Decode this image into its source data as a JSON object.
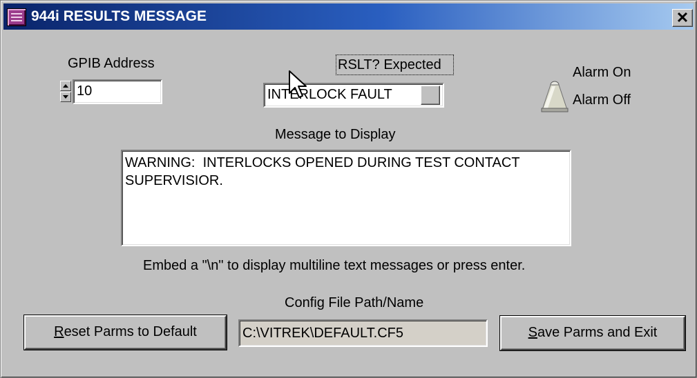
{
  "window": {
    "title": "944i RESULTS MESSAGE",
    "close_label": "✕"
  },
  "gpib": {
    "label": "GPIB Address",
    "value": "10"
  },
  "rslt": {
    "label": "RSLT? Expected",
    "selected": "INTERLOCK FAULT"
  },
  "alarm": {
    "on_label": "Alarm On",
    "off_label": "Alarm Off",
    "state": "off"
  },
  "message": {
    "label": "Message to Display",
    "value": "WARNING:  INTERLOCKS OPENED DURING TEST CONTACT SUPERVISIOR.",
    "hint": "Embed a \"\\n\" to display multiline text messages or press enter."
  },
  "config": {
    "label": "Config File Path/Name",
    "value": "C:\\VITREK\\DEFAULT.CF5"
  },
  "buttons": {
    "reset_hotkey": "R",
    "reset_rest": "eset Parms to Default",
    "save_hotkey": "S",
    "save_rest": "ave Parms and Exit"
  }
}
